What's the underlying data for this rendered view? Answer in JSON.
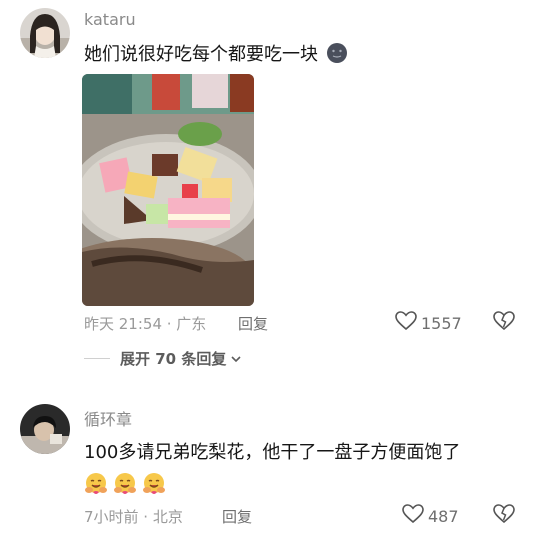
{
  "comments": [
    {
      "username": "kataru",
      "text": "她们说很好吃每个都要吃一块",
      "time": "昨天 21:54 · 广东",
      "reply_label": "回复",
      "likes": "1557"
    },
    {
      "username": "循环章",
      "text": "100多请兄弟吃梨花，他干了一盘子方便面饱了",
      "time": "7小时前 · 北京",
      "reply_label": "回复",
      "likes": "487"
    }
  ],
  "expand_replies": "展开 70 条回复",
  "icons": {
    "emoji_first": "dark-smile-emoji",
    "emoji_second": "hug-face-emoji",
    "like": "heart-outline-icon",
    "dislike": "broken-heart-icon",
    "expand": "chevron-down-icon"
  }
}
